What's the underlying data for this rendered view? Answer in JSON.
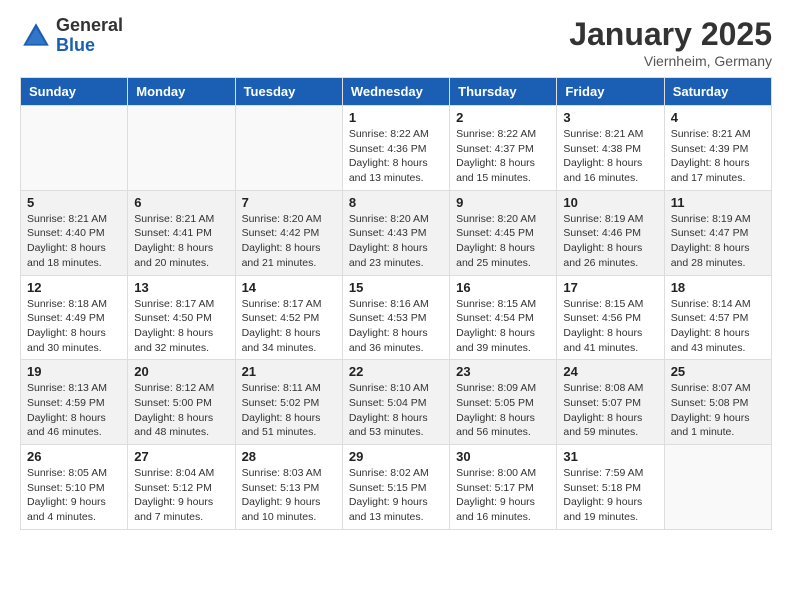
{
  "logo": {
    "general": "General",
    "blue": "Blue"
  },
  "title": "January 2025",
  "location": "Viernheim, Germany",
  "days_of_week": [
    "Sunday",
    "Monday",
    "Tuesday",
    "Wednesday",
    "Thursday",
    "Friday",
    "Saturday"
  ],
  "weeks": [
    [
      {
        "day": "",
        "info": ""
      },
      {
        "day": "",
        "info": ""
      },
      {
        "day": "",
        "info": ""
      },
      {
        "day": "1",
        "info": "Sunrise: 8:22 AM\nSunset: 4:36 PM\nDaylight: 8 hours\nand 13 minutes."
      },
      {
        "day": "2",
        "info": "Sunrise: 8:22 AM\nSunset: 4:37 PM\nDaylight: 8 hours\nand 15 minutes."
      },
      {
        "day": "3",
        "info": "Sunrise: 8:21 AM\nSunset: 4:38 PM\nDaylight: 8 hours\nand 16 minutes."
      },
      {
        "day": "4",
        "info": "Sunrise: 8:21 AM\nSunset: 4:39 PM\nDaylight: 8 hours\nand 17 minutes."
      }
    ],
    [
      {
        "day": "5",
        "info": "Sunrise: 8:21 AM\nSunset: 4:40 PM\nDaylight: 8 hours\nand 18 minutes."
      },
      {
        "day": "6",
        "info": "Sunrise: 8:21 AM\nSunset: 4:41 PM\nDaylight: 8 hours\nand 20 minutes."
      },
      {
        "day": "7",
        "info": "Sunrise: 8:20 AM\nSunset: 4:42 PM\nDaylight: 8 hours\nand 21 minutes."
      },
      {
        "day": "8",
        "info": "Sunrise: 8:20 AM\nSunset: 4:43 PM\nDaylight: 8 hours\nand 23 minutes."
      },
      {
        "day": "9",
        "info": "Sunrise: 8:20 AM\nSunset: 4:45 PM\nDaylight: 8 hours\nand 25 minutes."
      },
      {
        "day": "10",
        "info": "Sunrise: 8:19 AM\nSunset: 4:46 PM\nDaylight: 8 hours\nand 26 minutes."
      },
      {
        "day": "11",
        "info": "Sunrise: 8:19 AM\nSunset: 4:47 PM\nDaylight: 8 hours\nand 28 minutes."
      }
    ],
    [
      {
        "day": "12",
        "info": "Sunrise: 8:18 AM\nSunset: 4:49 PM\nDaylight: 8 hours\nand 30 minutes."
      },
      {
        "day": "13",
        "info": "Sunrise: 8:17 AM\nSunset: 4:50 PM\nDaylight: 8 hours\nand 32 minutes."
      },
      {
        "day": "14",
        "info": "Sunrise: 8:17 AM\nSunset: 4:52 PM\nDaylight: 8 hours\nand 34 minutes."
      },
      {
        "day": "15",
        "info": "Sunrise: 8:16 AM\nSunset: 4:53 PM\nDaylight: 8 hours\nand 36 minutes."
      },
      {
        "day": "16",
        "info": "Sunrise: 8:15 AM\nSunset: 4:54 PM\nDaylight: 8 hours\nand 39 minutes."
      },
      {
        "day": "17",
        "info": "Sunrise: 8:15 AM\nSunset: 4:56 PM\nDaylight: 8 hours\nand 41 minutes."
      },
      {
        "day": "18",
        "info": "Sunrise: 8:14 AM\nSunset: 4:57 PM\nDaylight: 8 hours\nand 43 minutes."
      }
    ],
    [
      {
        "day": "19",
        "info": "Sunrise: 8:13 AM\nSunset: 4:59 PM\nDaylight: 8 hours\nand 46 minutes."
      },
      {
        "day": "20",
        "info": "Sunrise: 8:12 AM\nSunset: 5:00 PM\nDaylight: 8 hours\nand 48 minutes."
      },
      {
        "day": "21",
        "info": "Sunrise: 8:11 AM\nSunset: 5:02 PM\nDaylight: 8 hours\nand 51 minutes."
      },
      {
        "day": "22",
        "info": "Sunrise: 8:10 AM\nSunset: 5:04 PM\nDaylight: 8 hours\nand 53 minutes."
      },
      {
        "day": "23",
        "info": "Sunrise: 8:09 AM\nSunset: 5:05 PM\nDaylight: 8 hours\nand 56 minutes."
      },
      {
        "day": "24",
        "info": "Sunrise: 8:08 AM\nSunset: 5:07 PM\nDaylight: 8 hours\nand 59 minutes."
      },
      {
        "day": "25",
        "info": "Sunrise: 8:07 AM\nSunset: 5:08 PM\nDaylight: 9 hours\nand 1 minute."
      }
    ],
    [
      {
        "day": "26",
        "info": "Sunrise: 8:05 AM\nSunset: 5:10 PM\nDaylight: 9 hours\nand 4 minutes."
      },
      {
        "day": "27",
        "info": "Sunrise: 8:04 AM\nSunset: 5:12 PM\nDaylight: 9 hours\nand 7 minutes."
      },
      {
        "day": "28",
        "info": "Sunrise: 8:03 AM\nSunset: 5:13 PM\nDaylight: 9 hours\nand 10 minutes."
      },
      {
        "day": "29",
        "info": "Sunrise: 8:02 AM\nSunset: 5:15 PM\nDaylight: 9 hours\nand 13 minutes."
      },
      {
        "day": "30",
        "info": "Sunrise: 8:00 AM\nSunset: 5:17 PM\nDaylight: 9 hours\nand 16 minutes."
      },
      {
        "day": "31",
        "info": "Sunrise: 7:59 AM\nSunset: 5:18 PM\nDaylight: 9 hours\nand 19 minutes."
      },
      {
        "day": "",
        "info": ""
      }
    ]
  ]
}
